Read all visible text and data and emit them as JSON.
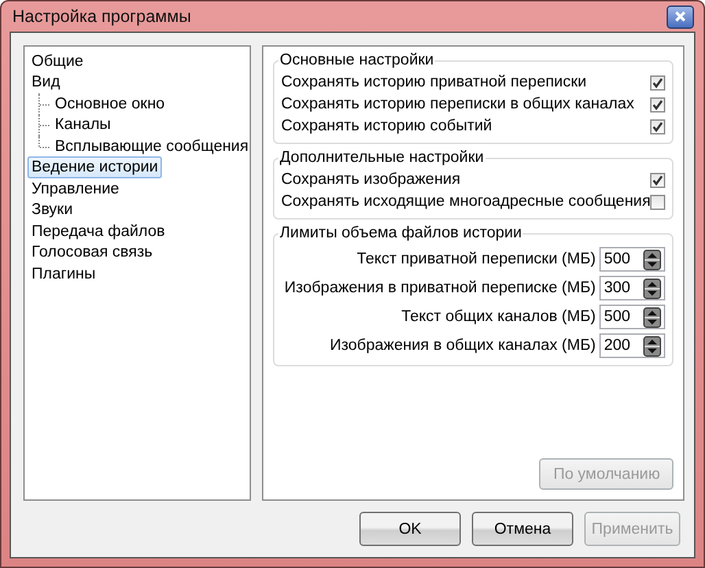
{
  "window": {
    "title": "Настройка программы"
  },
  "sidebar": {
    "items": [
      {
        "label": "Общие",
        "selected": false
      },
      {
        "label": "Вид",
        "selected": false,
        "children": [
          {
            "label": "Основное окно",
            "selected": false
          },
          {
            "label": "Каналы",
            "selected": false
          },
          {
            "label": "Всплывающие сообщения",
            "selected": false
          }
        ]
      },
      {
        "label": "Ведение истории",
        "selected": true
      },
      {
        "label": "Управление",
        "selected": false
      },
      {
        "label": "Звуки",
        "selected": false
      },
      {
        "label": "Передача файлов",
        "selected": false
      },
      {
        "label": "Голосовая связь",
        "selected": false
      },
      {
        "label": "Плагины",
        "selected": false
      }
    ]
  },
  "groups": [
    {
      "title": "Основные настройки",
      "kind": "checks",
      "items": [
        {
          "label": "Сохранять историю приватной переписки",
          "checked": true
        },
        {
          "label": "Сохранять историю переписки в общих каналах",
          "checked": true
        },
        {
          "label": "Сохранять историю событий",
          "checked": true
        }
      ]
    },
    {
      "title": "Дополнительные настройки",
      "kind": "checks",
      "items": [
        {
          "label": "Сохранять изображения",
          "checked": true
        },
        {
          "label": "Сохранять исходящие многоадресные сообщения",
          "checked": false
        }
      ]
    },
    {
      "title": "Лимиты объема файлов истории",
      "kind": "limits",
      "items": [
        {
          "label": "Текст приватной переписки (МБ)",
          "value": "500"
        },
        {
          "label": "Изображения в приватной переписке (МБ)",
          "value": "300"
        },
        {
          "label": "Текст общих каналов (МБ)",
          "value": "500"
        },
        {
          "label": "Изображения в общих каналах (МБ)",
          "value": "200"
        }
      ]
    }
  ],
  "default_button": {
    "label": "По умолчанию",
    "disabled": true
  },
  "buttons": [
    {
      "label": "OK",
      "disabled": false
    },
    {
      "label": "Отмена",
      "disabled": false
    },
    {
      "label": "Применить",
      "disabled": true
    }
  ]
}
